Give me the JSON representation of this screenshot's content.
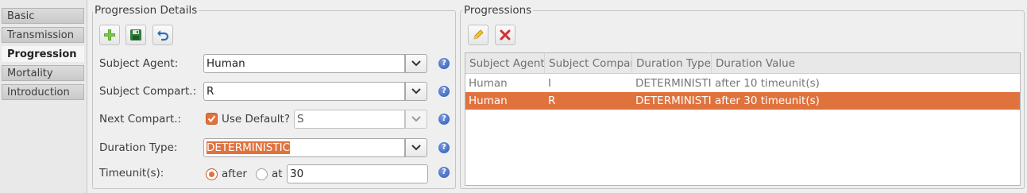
{
  "tabs": [
    "Basic",
    "Transmission",
    "Progression",
    "Mortality",
    "Introduction"
  ],
  "details": {
    "title": "Progression Details",
    "toolbar": {
      "add_icon": "add-icon",
      "save_icon": "save-icon",
      "undo_icon": "undo-icon"
    },
    "subject_agent": {
      "label": "Subject Agent:",
      "value": "Human"
    },
    "subject_compart": {
      "label": "Subject Compart.:",
      "value": "R"
    },
    "next_compart": {
      "label": "Next Compart.:",
      "use_default_label": "Use Default?",
      "use_default_checked": true,
      "value": "S"
    },
    "duration_type": {
      "label": "Duration Type:",
      "value": "DETERMINISTIC"
    },
    "timeunit": {
      "label": "Timeunit(s):",
      "after_label": "after",
      "at_label": "at",
      "selected": "after",
      "value": "30"
    },
    "help_glyph": "?"
  },
  "progressions": {
    "title": "Progressions",
    "toolbar": {
      "edit_icon": "pencil-icon",
      "delete_icon": "delete-icon"
    },
    "columns": [
      "Subject Agent",
      "Subject Compartment",
      "Duration Type",
      "Duration Value"
    ],
    "rows": [
      {
        "agent": "Human",
        "compart": "I",
        "type": "DETERMINISTIC",
        "value": "after 10 timeunit(s)",
        "selected": false
      },
      {
        "agent": "Human",
        "compart": "R",
        "type": "DETERMINISTIC",
        "value": "after 30 timeunit(s)",
        "selected": true
      }
    ]
  },
  "colors": {
    "accent": "#e0723d",
    "help": "#3b63c4"
  }
}
